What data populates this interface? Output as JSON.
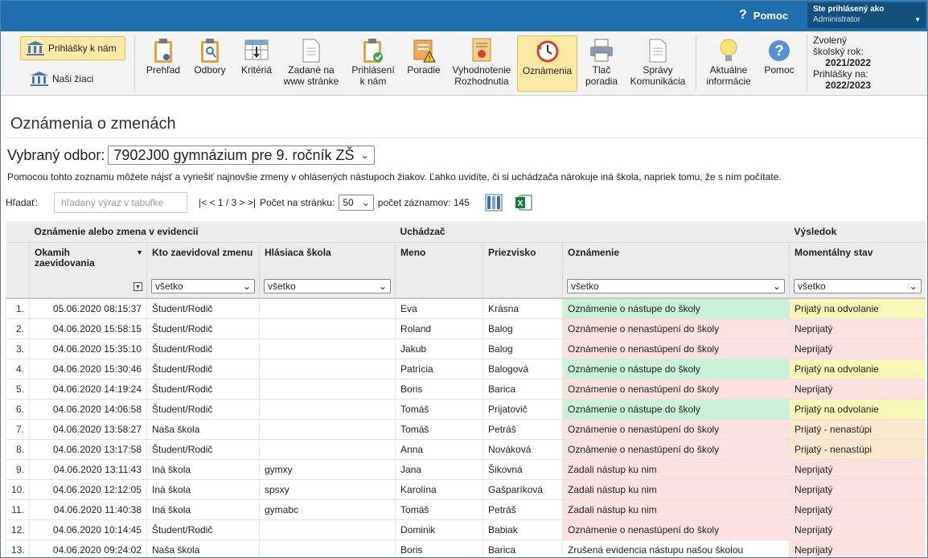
{
  "topbar": {
    "help_label": "Pomoc",
    "user_heading": "Ste prihlásený ako",
    "user_name": "Administrator"
  },
  "toolbar": {
    "left": [
      {
        "label": "Prihlášky k nám",
        "active": true
      },
      {
        "label": "Naši žiaci",
        "active": false
      }
    ],
    "buttons": [
      {
        "label": "Prehľad",
        "icon": "clipboard-eye-icon"
      },
      {
        "label": "Odbory",
        "icon": "clipboard-search-icon"
      },
      {
        "label": "Kritériá",
        "icon": "table-arrow-icon"
      },
      {
        "label": "Zadané na www stránke",
        "icon": "document-icon"
      },
      {
        "label": "Prihlásení k nám",
        "icon": "clipboard-check-icon"
      },
      {
        "label": "Poradie",
        "icon": "ranking-warning-icon"
      },
      {
        "label": "Vyhodnotenie Rozhodnutia",
        "icon": "certificate-icon"
      },
      {
        "label": "Oznámenia",
        "icon": "clock-history-icon",
        "active": true
      },
      {
        "label": "Tlač poradia",
        "icon": "printer-icon"
      },
      {
        "label": "Správy Komunikácia",
        "icon": "message-document-icon"
      },
      {
        "label": "Aktuálne informácie",
        "icon": "lightbulb-icon"
      },
      {
        "label": "Pomoc",
        "icon": "help-circle-icon"
      }
    ],
    "year_label": "Zvolený školský rok:",
    "year_value": "2021/2022",
    "apps_label": "Prihlášky na:",
    "apps_value": "2022/2023"
  },
  "page": {
    "title": "Oznámenia o zmenách",
    "odbor_label": "Vybraný odbor:",
    "odbor_value": "7902J00 gymnázium pre 9. ročník ZŠ",
    "description": "Pomocou tohto zoznamu môžete nájsť a vyriešiť najnovšie zmeny v ohlásených nástupoch žiakov. Ľahko uvidíte, či si uchádzača nárokuje iná škola, napriek tomu, že s ním počítate.",
    "search_label": "Hľadať:",
    "search_placeholder": "hľadaný výraz v tabuľke",
    "pager_text": "|< < 1 / 3 > >|",
    "per_page_label": "Počet na stránku:",
    "per_page_value": "50",
    "record_count": "počet záznamov: 145"
  },
  "table": {
    "groups": [
      "Oznámenie alebo zmena v evidencii",
      "Uchádzač",
      "Výsledok"
    ],
    "columns": [
      "Okamih zaevidovania",
      "Kto zaevidoval zmenu",
      "Hlásiaca škola",
      "Meno",
      "Priezvisko",
      "Oznámenie",
      "Momentálny stav"
    ],
    "filter_value": "všetko",
    "rows": [
      {
        "n": "1.",
        "time": "05.06.2020 08:15:37",
        "who": "Študent/Rodič",
        "school": "",
        "first": "Eva",
        "last": "Krásna",
        "note": "Oznámenie o nástupe do školy",
        "state": "Prijatý na odvolanie",
        "nc": "green",
        "sc": "yellow"
      },
      {
        "n": "2.",
        "time": "04.06.2020 15:58:15",
        "who": "Študent/Rodič",
        "school": "",
        "first": "Roland",
        "last": "Balog",
        "note": "Oznámenie o nenastúpení do školy",
        "state": "Neprijatý",
        "nc": "red",
        "sc": "red"
      },
      {
        "n": "3.",
        "time": "04.06.2020 15:35:10",
        "who": "Študent/Rodič",
        "school": "",
        "first": "Jakub",
        "last": "Balog",
        "note": "Oznámenie o nenastúpení do školy",
        "state": "Neprijatý",
        "nc": "red",
        "sc": "red"
      },
      {
        "n": "4.",
        "time": "04.06.2020 15:30:46",
        "who": "Študent/Rodič",
        "school": "",
        "first": "Patrícia",
        "last": "Balogová",
        "note": "Oznámenie o nástupe do školy",
        "state": "Prijatý na odvolanie",
        "nc": "green",
        "sc": "yellow"
      },
      {
        "n": "5.",
        "time": "04.06.2020 14:19:24",
        "who": "Študent/Rodič",
        "school": "",
        "first": "Boris",
        "last": "Barica",
        "note": "Oznámenie o nenastúpení do školy",
        "state": "Neprijatý",
        "nc": "red",
        "sc": "red"
      },
      {
        "n": "6.",
        "time": "04.06.2020 14:06:58",
        "who": "Študent/Rodič",
        "school": "",
        "first": "Tomáš",
        "last": "Prijatovič",
        "note": "Oznámenie o nástupe do školy",
        "state": "Prijatý na odvolanie",
        "nc": "green",
        "sc": "yellow"
      },
      {
        "n": "7.",
        "time": "04.06.2020 13:58:27",
        "who": "Naša škola",
        "school": "",
        "first": "Tomáš",
        "last": "Petráš",
        "note": "Oznámenie o nenastúpení do školy",
        "state": "Prijatý - nenastúpi",
        "nc": "red",
        "sc": "orange"
      },
      {
        "n": "8.",
        "time": "04.06.2020 13:17:58",
        "who": "Študent/Rodič",
        "school": "",
        "first": "Anna",
        "last": "Nováková",
        "note": "Oznámenie o nenastúpení do školy",
        "state": "Prijatý - nenastúpi",
        "nc": "red",
        "sc": "orange"
      },
      {
        "n": "9.",
        "time": "04.06.2020 13:11:43",
        "who": "Iná škola",
        "school": "gymxy",
        "first": "Jana",
        "last": "Šikovná",
        "note": "Zadali nástup ku nim",
        "state": "Neprijatý",
        "nc": "red",
        "sc": "red"
      },
      {
        "n": "10.",
        "time": "04.06.2020 12:12:05",
        "who": "Iná škola",
        "school": "spsxy",
        "first": "Karolína",
        "last": "Gašparíková",
        "note": "Zadali nástup ku nim",
        "state": "Neprijatý",
        "nc": "red",
        "sc": "red"
      },
      {
        "n": "11.",
        "time": "04.06.2020 11:40:38",
        "who": "Iná škola",
        "school": "gymabc",
        "first": "Tomáš",
        "last": "Petráš",
        "note": "Zadali nástup ku nim",
        "state": "Neprijatý",
        "nc": "red",
        "sc": "red"
      },
      {
        "n": "12.",
        "time": "04.06.2020 10:14:45",
        "who": "Študent/Rodič",
        "school": "",
        "first": "Dominik",
        "last": "Babiak",
        "note": "Oznámenie o nenastúpení do školy",
        "state": "Neprijatý",
        "nc": "red",
        "sc": "red"
      },
      {
        "n": "13.",
        "time": "04.06.2020 09:24:02",
        "who": "Naša škola",
        "school": "",
        "first": "Boris",
        "last": "Barica",
        "note": "Zrušená evidencia nástupu našou školou",
        "state": "Neprijatý",
        "nc": "white",
        "sc": "red"
      }
    ]
  }
}
